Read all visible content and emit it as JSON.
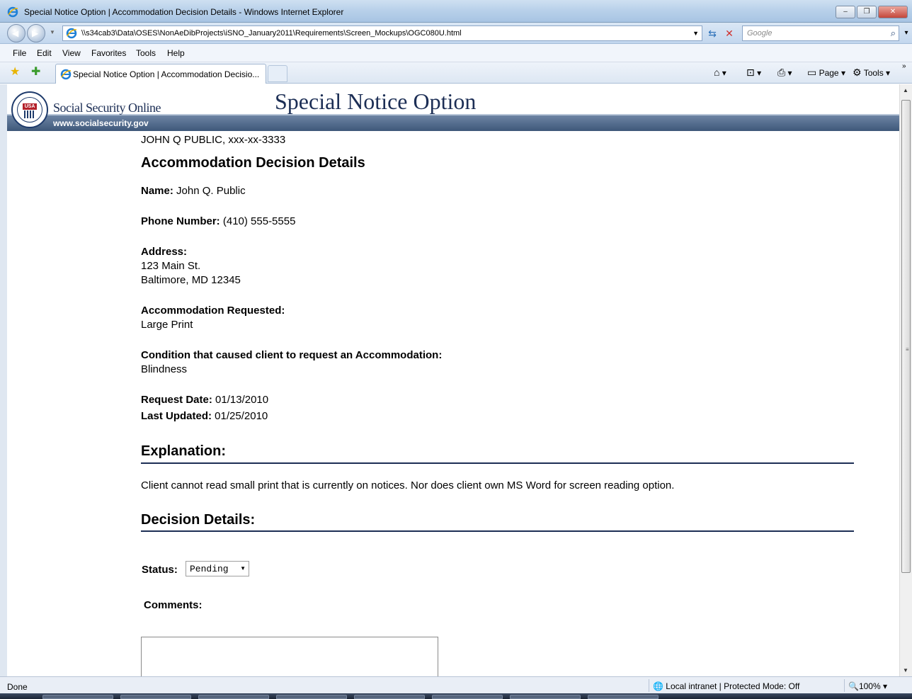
{
  "window": {
    "title": "Special Notice Option | Accommodation Decision Details - Windows Internet Explorer",
    "minimize": "–",
    "restore": "❐",
    "close": "✕"
  },
  "address": {
    "url": "\\\\s34cab3\\Data\\OSES\\NonAeDibProjects\\iSNO_January2011\\Requirements\\Screen_Mockups\\OGC080U.html",
    "search_placeholder": "Google"
  },
  "menu": [
    "File",
    "Edit",
    "View",
    "Favorites",
    "Tools",
    "Help"
  ],
  "tab": {
    "title": "Special Notice Option | Accommodation Decisio..."
  },
  "commands": {
    "page": "Page",
    "tools": "Tools"
  },
  "site": {
    "brand": "Social Security Online",
    "url": "www.socialsecurity.gov",
    "title": "Special Notice Option",
    "seal_text": "USA"
  },
  "content": {
    "client": "JOHN Q PUBLIC, xxx-xx-3333",
    "heading": "Accommodation Decision Details",
    "name_label": "Name:",
    "name_value": " John Q. Public",
    "phone_label": "Phone Number:",
    "phone_value": " (410) 555-5555",
    "address_label": "Address:",
    "address_line1": "123 Main St.",
    "address_line2": "Baltimore, MD 12345",
    "accommodation_label": "Accommodation Requested:",
    "accommodation_value": "Large Print",
    "condition_label": "Condition that caused client to request an Accommodation:",
    "condition_value": "Blindness",
    "request_date_label": "Request Date:",
    "request_date_value": " 01/13/2010",
    "last_updated_label": "Last Updated:",
    "last_updated_value": " 01/25/2010",
    "explanation_heading": "Explanation:",
    "explanation_text": "Client cannot read small print that is currently on notices. Nor does client own MS Word for screen reading option.",
    "decision_heading": "Decision Details:",
    "status_label": "Status:",
    "status_value": "Pending",
    "comments_label": "Comments:"
  },
  "status": {
    "text": "Done",
    "zone": "Local intranet | Protected Mode: Off",
    "zoom": "100%"
  }
}
